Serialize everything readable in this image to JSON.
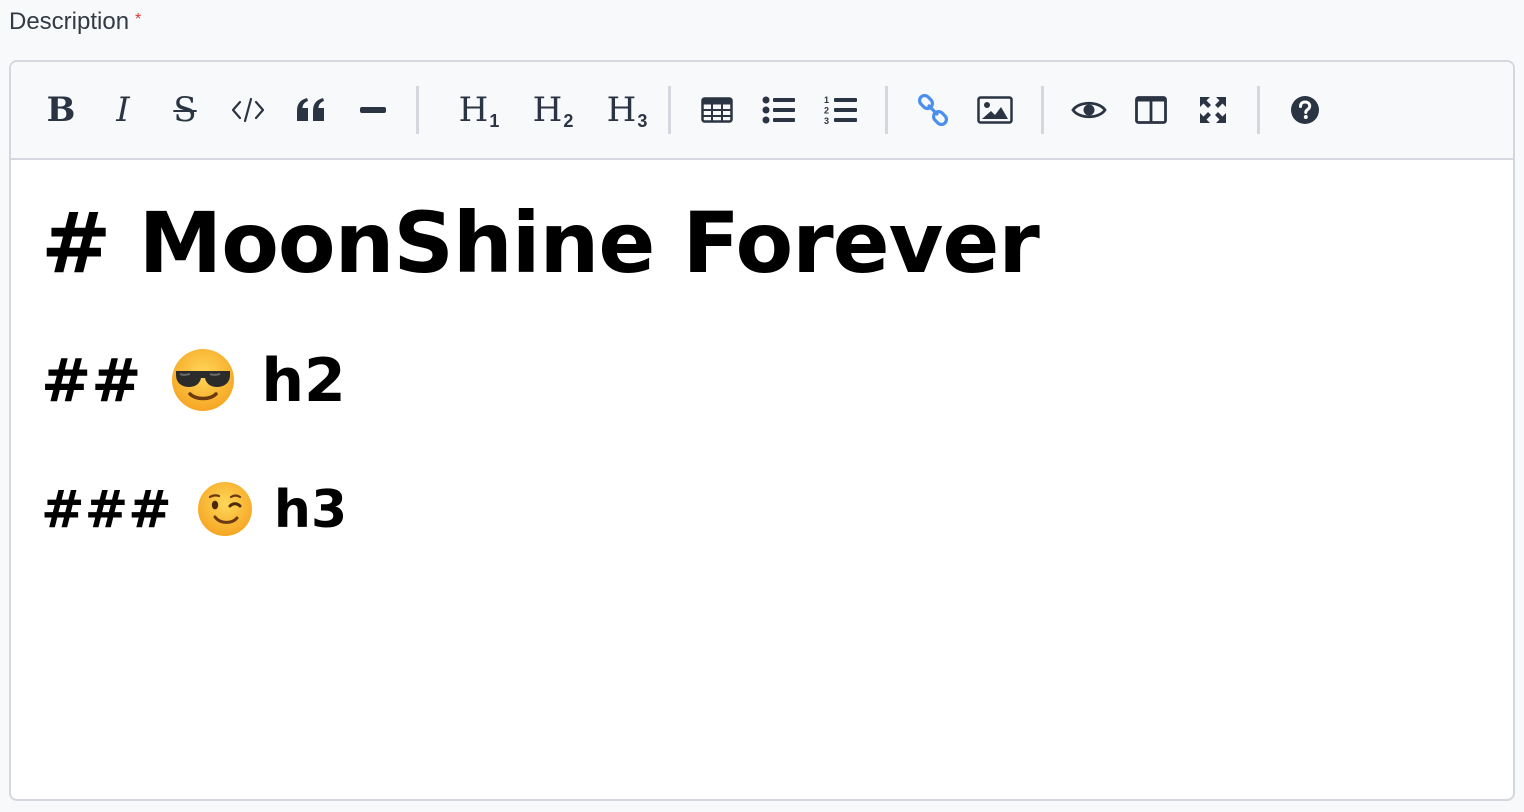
{
  "field": {
    "label": "Description",
    "required_mark": "*"
  },
  "toolbar": {
    "groups": [
      [
        "bold-icon",
        "italic-icon",
        "strikethrough-icon",
        "code-icon",
        "quote-icon",
        "horizontal-rule-icon"
      ],
      [
        "heading-1-icon",
        "heading-2-icon",
        "heading-3-icon"
      ],
      [
        "table-icon",
        "unordered-list-icon",
        "ordered-list-icon"
      ],
      [
        "link-icon",
        "image-icon"
      ],
      [
        "preview-icon",
        "side-by-side-icon",
        "fullscreen-icon"
      ],
      [
        "help-icon"
      ]
    ],
    "bold_label": "B",
    "italic_label": "I",
    "strike_label": "S",
    "h1_label": "H",
    "h1_sub": "1",
    "h2_label": "H",
    "h2_sub": "2",
    "h3_label": "H",
    "h3_sub": "3"
  },
  "colors": {
    "icon": "#2a3443",
    "link_icon": "#4a8ff0",
    "border": "#d4d8de",
    "required": "#e03131"
  },
  "content": {
    "line1": "# MoonShine Forever",
    "line2_prefix": "## ",
    "line2_emoji": "smiling-face-with-sunglasses",
    "line2_suffix": " h2",
    "line3_prefix": "### ",
    "line3_emoji": "winking-face",
    "line3_suffix": " h3"
  }
}
